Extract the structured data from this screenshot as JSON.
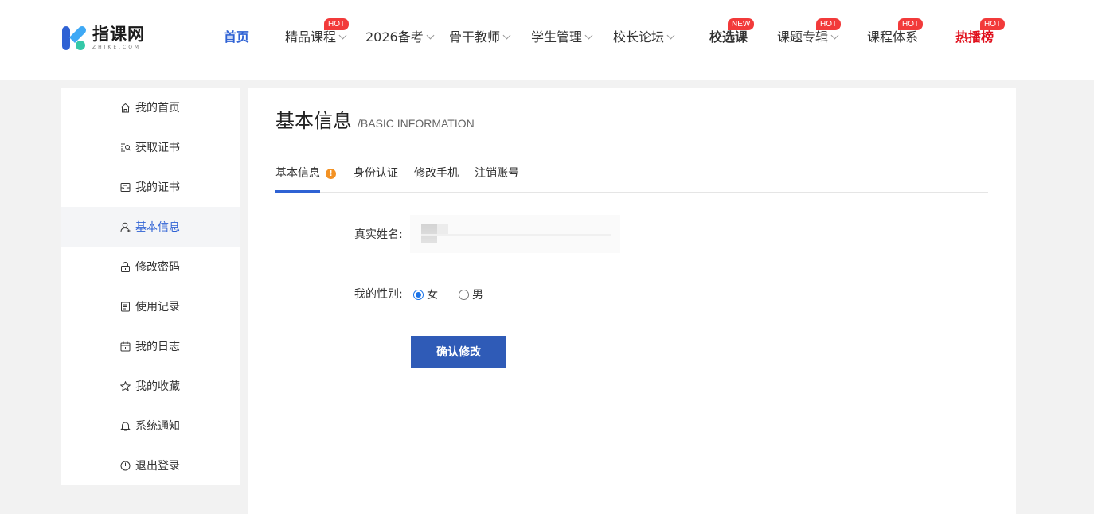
{
  "logo": {
    "name_cn": "指课网",
    "name_en": "ZHIKE.COM"
  },
  "colors": {
    "accent": "#2f62d4",
    "button": "#2f5bb7",
    "hot_badge": "#f23a3a",
    "hot_red": "#e0101c",
    "alert": "#f39224"
  },
  "nav": {
    "home": "首页",
    "items": [
      {
        "label": "精品课程",
        "badge": "HOT",
        "dropdown": true
      },
      {
        "label": "2026备考",
        "dropdown": true
      },
      {
        "label": "骨干教师",
        "dropdown": true
      },
      {
        "label": "学生管理",
        "dropdown": true
      },
      {
        "label": "校长论坛",
        "dropdown": true
      },
      {
        "label": "校选课",
        "badge": "NEW"
      },
      {
        "label": "课题专辑",
        "badge": "HOT",
        "dropdown": true
      },
      {
        "label": "课程体系",
        "badge": "HOT"
      },
      {
        "label": "热播榜",
        "badge": "HOT"
      }
    ]
  },
  "sidebar": {
    "items": [
      {
        "label": "我的首页",
        "icon": "home-icon"
      },
      {
        "label": "获取证书",
        "icon": "certificate-search-icon"
      },
      {
        "label": "我的证书",
        "icon": "certificate-icon"
      },
      {
        "label": "基本信息",
        "icon": "user-icon",
        "active": true
      },
      {
        "label": "修改密码",
        "icon": "lock-icon"
      },
      {
        "label": "使用记录",
        "icon": "record-icon"
      },
      {
        "label": "我的日志",
        "icon": "calendar-icon"
      },
      {
        "label": "我的收藏",
        "icon": "star-icon"
      },
      {
        "label": "系统通知",
        "icon": "bell-icon"
      },
      {
        "label": "退出登录",
        "icon": "power-icon"
      }
    ]
  },
  "main": {
    "title": "基本信息",
    "subtitle": "/BASIC INFORMATION",
    "tabs": [
      {
        "label": "基本信息",
        "alert": "!",
        "active": true
      },
      {
        "label": "身份认证"
      },
      {
        "label": "修改手机"
      },
      {
        "label": "注销账号"
      }
    ],
    "form": {
      "name_label": "真实姓名:",
      "name_value": "",
      "gender_label": "我的性别:",
      "gender_options": [
        {
          "label": "女",
          "checked": true
        },
        {
          "label": "男",
          "checked": false
        }
      ],
      "submit_label": "确认修改"
    }
  }
}
